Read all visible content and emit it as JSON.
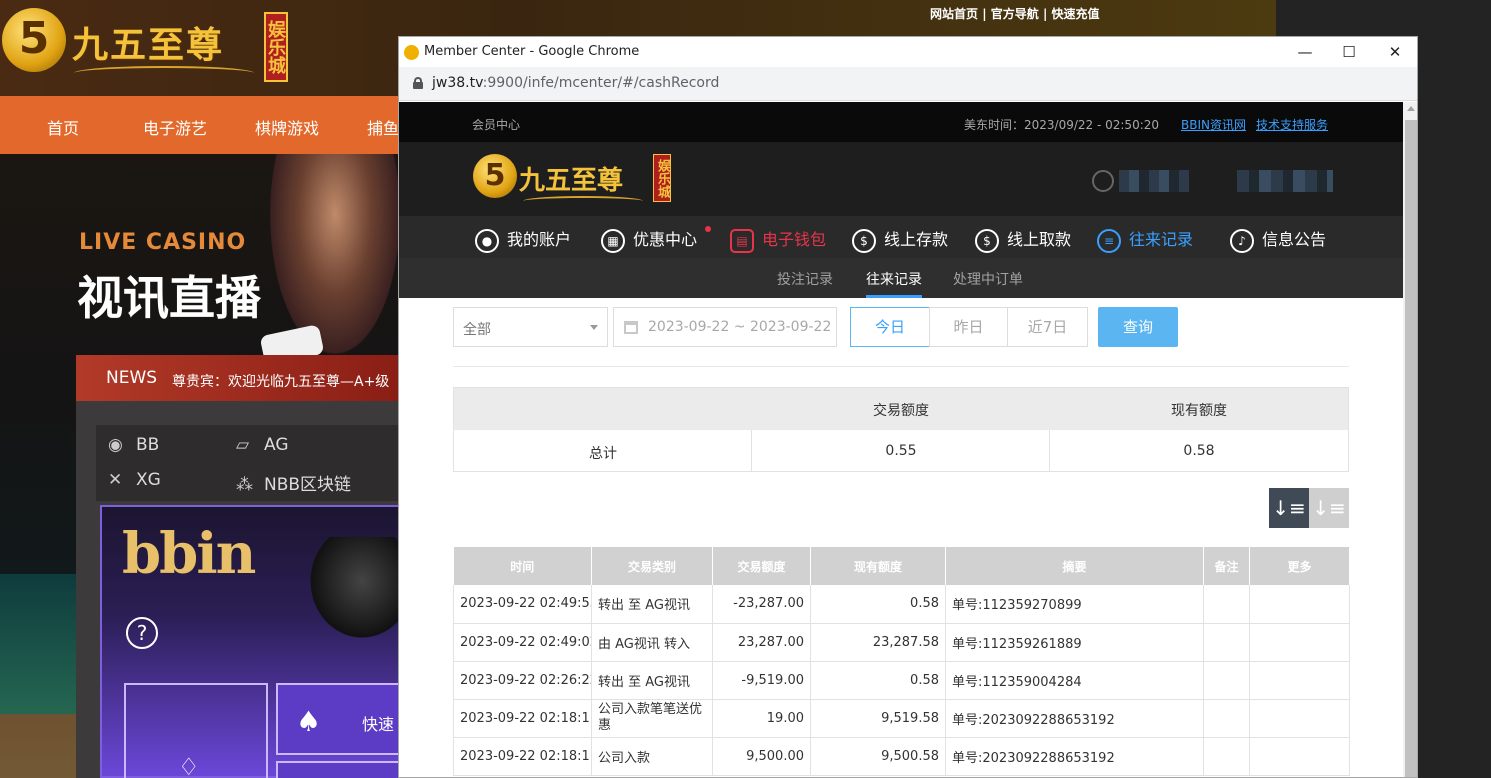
{
  "background_site": {
    "top_links": [
      "网站首页",
      "官方导航",
      "快速充值"
    ],
    "logo": {
      "name": "九五至尊",
      "sub": "娱乐城",
      "mark": "5"
    },
    "nav": [
      "首页",
      "电子游艺",
      "棋牌游戏",
      "捕鱼"
    ],
    "hero": {
      "eyebrow": "LIVE CASINO",
      "title": "视讯直播"
    },
    "news": {
      "label": "NEWS",
      "ticker": "尊贵宾：欢迎光临九五至尊—A+级"
    },
    "providers": [
      {
        "icon": "bb-icon",
        "label": "BB"
      },
      {
        "icon": "ag-icon",
        "label": "AG"
      },
      {
        "icon": "xg-icon",
        "label": "XG"
      },
      {
        "icon": "nbb-icon",
        "label": "NBB区块链"
      }
    ],
    "bbin_card": {
      "logo": "bbin",
      "help": "?",
      "quick_label": "快速"
    }
  },
  "window": {
    "title": "Member Center - Google Chrome",
    "url_host": "jw38.tv",
    "url_rest": ":9900/infe/mcenter/#/cashRecord",
    "controls": {
      "minimize": "—",
      "maximize": "☐",
      "close": "✕"
    }
  },
  "member_center": {
    "top": {
      "label": "会员中心",
      "time": "美东时间：2023/09/22 - 02:50:20",
      "link1": "BBIN资讯网",
      "link2": "技术支持服务"
    },
    "logo": {
      "name": "九五至尊",
      "sub": "娱乐城",
      "mark": "5"
    },
    "nav": [
      {
        "icon": "account-icon",
        "label": "我的账户"
      },
      {
        "icon": "promo-icon",
        "label": "优惠中心"
      },
      {
        "icon": "wallet-icon",
        "label": "电子钱包"
      },
      {
        "icon": "deposit-icon",
        "label": "线上存款"
      },
      {
        "icon": "withdraw-icon",
        "label": "线上取款"
      },
      {
        "icon": "records-icon",
        "label": "往来记录"
      },
      {
        "icon": "notice-icon",
        "label": "信息公告"
      }
    ],
    "subnav": [
      "投注记录",
      "往来记录",
      "处理中订单"
    ],
    "filters": {
      "type_select": "全部",
      "date_range": "2023-09-22 ~ 2023-09-22",
      "quick": [
        "今日",
        "昨日",
        "近7日"
      ],
      "search": "查询"
    },
    "summary": {
      "headers": [
        "交易额度",
        "现有额度"
      ],
      "row_label": "总计",
      "amount": "0.55",
      "balance": "0.58"
    },
    "sort": {
      "desc": "↓≡",
      "asc": "↓≡"
    },
    "table": {
      "headers": [
        "时间",
        "交易类别",
        "交易额度",
        "现有额度",
        "摘要",
        "备注",
        "更多"
      ],
      "rows": [
        [
          "2023-09-22 02:49:53",
          "转出 至 AG视讯",
          "-23,287.00",
          "0.58",
          "单号:112359270899",
          "",
          ""
        ],
        [
          "2023-09-22 02:49:02",
          "由 AG视讯 转入",
          "23,287.00",
          "23,287.58",
          "单号:112359261889",
          "",
          ""
        ],
        [
          "2023-09-22 02:26:22",
          "转出 至 AG视讯",
          "-9,519.00",
          "0.58",
          "单号:112359004284",
          "",
          ""
        ],
        [
          "2023-09-22 02:18:11",
          "公司入款笔笔送优惠",
          "19.00",
          "9,519.58",
          "单号:2023092288653192",
          "",
          ""
        ],
        [
          "2023-09-22 02:18:11",
          "公司入款",
          "9,500.00",
          "9,500.58",
          "单号:2023092288653192",
          "",
          ""
        ]
      ]
    }
  }
}
